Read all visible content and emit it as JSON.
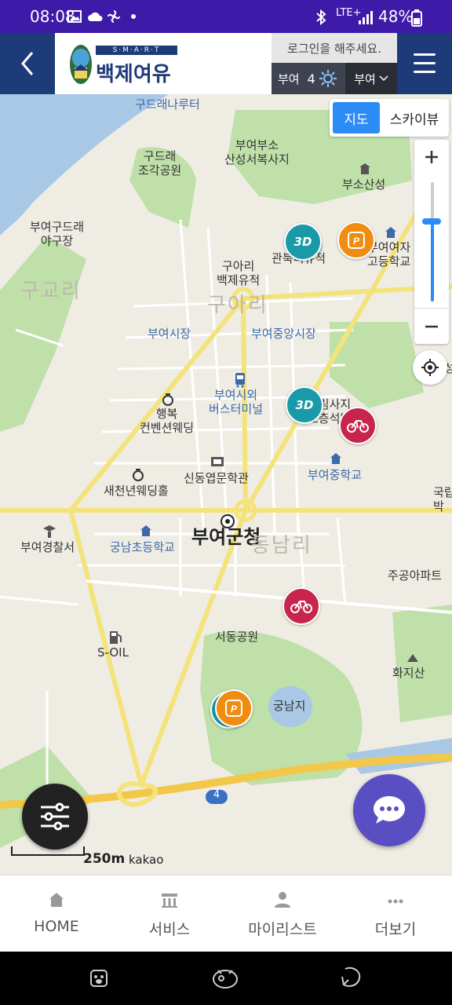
{
  "status_bar": {
    "time": "08:08",
    "network": "LTE+",
    "battery": "48%"
  },
  "header": {
    "logo_top": "S·M·A·R·T",
    "logo_title": "백제여유",
    "login_prompt": "로그인을 해주세요.",
    "weather_city": "부여",
    "weather_temp": "4",
    "region_select": "부여"
  },
  "map": {
    "type_toggle": {
      "map": "지도",
      "sky": "스카이뷰"
    },
    "labels": {
      "gudeurae_pier": "구드래나루터",
      "busosan_temple": "부여부소\n산성서복사지",
      "gudeurae_park": "구드래\n조각공원",
      "busosanseong": "부소산성",
      "gudeurae_ballpark": "부여구드래\n야구장",
      "gugyo_ri": "구교리",
      "guari_site": "구아리\n백제유적",
      "guari_ghost": "구아리",
      "gwanbuk_site": "관북리유적",
      "girls_high": "부여여자\n고등학교",
      "buyeo_market": "부여시장",
      "central_market": "부여중앙시장",
      "bus_terminal": "부여시외\n버스터미널",
      "wedding_hall": "행복\n컨벤션웨딩",
      "stone_pagoda": "정림사지\n오층석탑",
      "middle_school": "부여중학교",
      "saecheonnyeon": "새천년웨딩홀",
      "sindong": "신동엽문학관",
      "police": "부여경찰서",
      "gungnam_elem": "궁남초등학교",
      "county_office": "부여군청",
      "dongnam_ri": "동남리",
      "jugong_apt": "주공아파트",
      "soil": "S-OIL",
      "seodong_park": "서동공원",
      "hwajisan": "화지산",
      "gungnamji": "궁남지",
      "gukrip": "국립\n박",
      "seong": "성",
      "route": "4"
    },
    "poi_3d": "3D",
    "poi_parking": "P",
    "scale_label": "250m",
    "provider": "kakao"
  },
  "tabbar": [
    {
      "label": "HOME",
      "icon": "home-icon"
    },
    {
      "label": "서비스",
      "icon": "building-icon"
    },
    {
      "label": "마이리스트",
      "icon": "person-icon"
    },
    {
      "label": "더보기",
      "icon": "more-icon"
    }
  ],
  "colors": {
    "header_nav": "#1d3b78",
    "status_bar": "#3d1aa8",
    "map_button_active": "#2b8cf6",
    "chat": "#5a4fc2"
  }
}
